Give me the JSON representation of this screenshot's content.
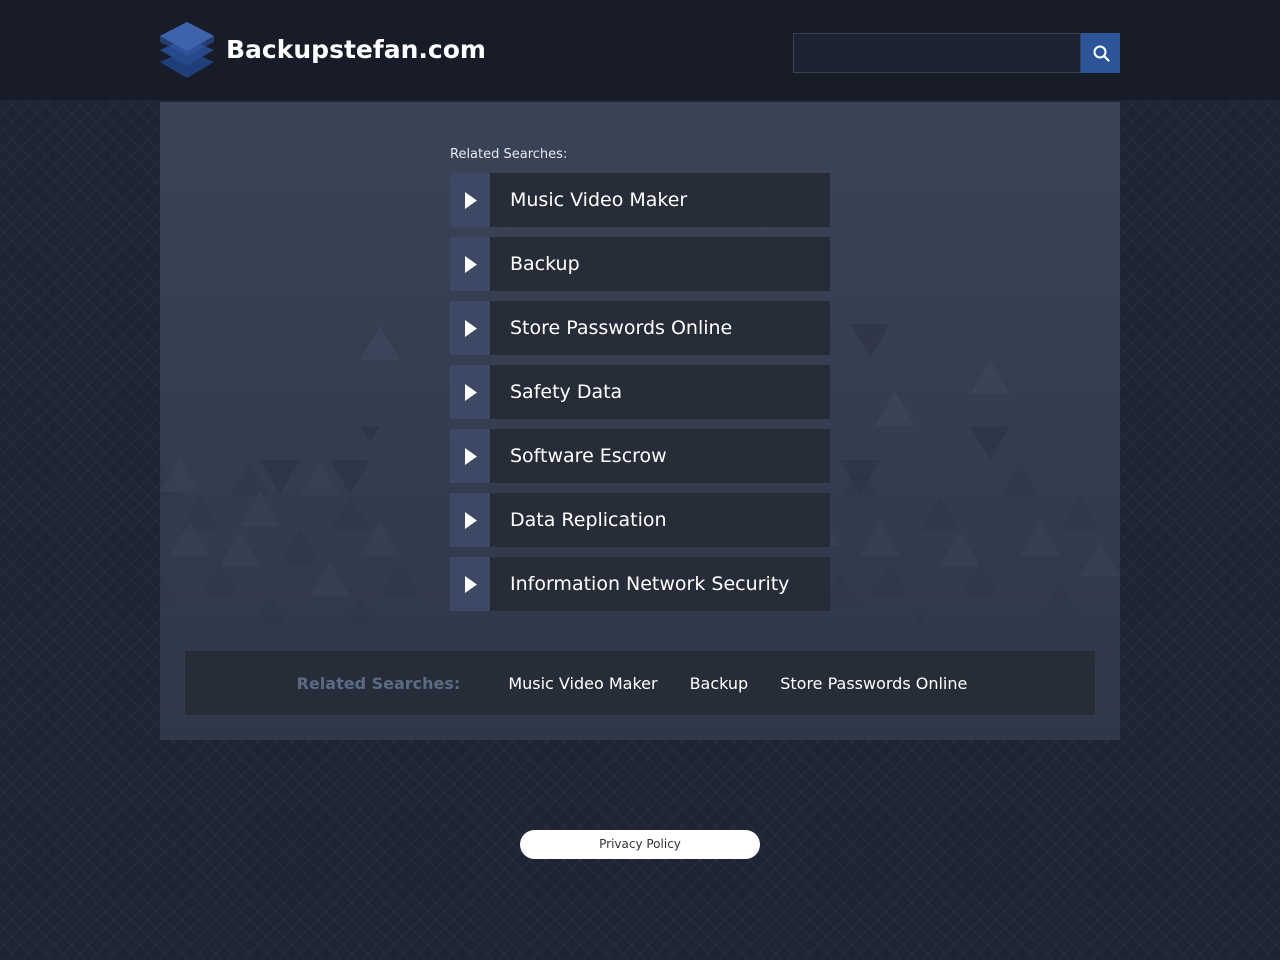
{
  "header": {
    "site_title": "Backupstefan.com",
    "logo_icon": "stacked-layers-icon",
    "search": {
      "value": "",
      "placeholder": "",
      "button_icon": "search-icon"
    }
  },
  "main": {
    "related_label": "Related Searches:",
    "links": [
      {
        "label": "Music Video Maker",
        "icon": "play-arrow-icon"
      },
      {
        "label": "Backup",
        "icon": "play-arrow-icon"
      },
      {
        "label": "Store Passwords Online",
        "icon": "play-arrow-icon"
      },
      {
        "label": "Safety Data",
        "icon": "play-arrow-icon"
      },
      {
        "label": "Software Escrow",
        "icon": "play-arrow-icon"
      },
      {
        "label": "Data Replication",
        "icon": "play-arrow-icon"
      },
      {
        "label": "Information Network Security",
        "icon": "play-arrow-icon"
      }
    ]
  },
  "bottom_bar": {
    "label": "Related Searches:",
    "links": [
      "Music Video Maker",
      "Backup",
      "Store Passwords Online"
    ]
  },
  "footer": {
    "privacy_label": "Privacy Policy"
  },
  "colors": {
    "accent": "#2c5599",
    "header_bg": "#171c28",
    "link_bg": "#262c38",
    "arrow_bg": "#3c4864"
  }
}
